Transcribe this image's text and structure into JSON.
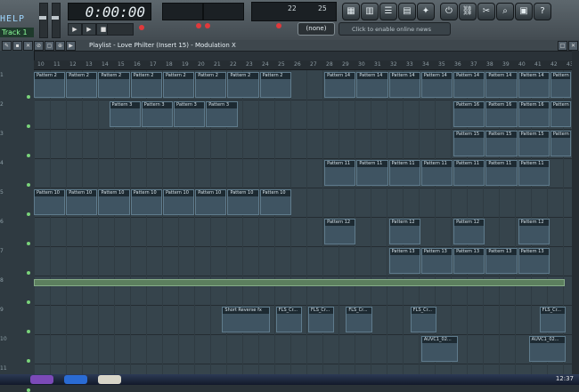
{
  "toolbar": {
    "help_label": "HELP",
    "track_label": "Track 1",
    "time": "0:00:00",
    "cpu": "22",
    "mem": "25",
    "mixer_preset": "(none)",
    "news_placeholder": "Click to enable online news"
  },
  "playlist": {
    "title": "Playlist - Love Philter (Insert 15) - Modulation X"
  },
  "ruler": {
    "bars": [
      10,
      11,
      12,
      13,
      14,
      15,
      16,
      17,
      18,
      19,
      20,
      21,
      22,
      23,
      24,
      25,
      26,
      27,
      28,
      29,
      30,
      31,
      32,
      33,
      34,
      35,
      36,
      37,
      38,
      39,
      40,
      41,
      42,
      43
    ]
  },
  "tracks": [
    {
      "num": "1"
    },
    {
      "num": "2"
    },
    {
      "num": "3"
    },
    {
      "num": "4"
    },
    {
      "num": "5"
    },
    {
      "num": "6"
    },
    {
      "num": "7"
    },
    {
      "num": "8"
    },
    {
      "num": "9"
    },
    {
      "num": "10"
    },
    {
      "num": "11"
    }
  ],
  "clips": [
    {
      "label": "Pattern 2",
      "track": 0,
      "start": 0,
      "len": 6
    },
    {
      "label": "Pattern 2",
      "track": 0,
      "start": 6,
      "len": 6
    },
    {
      "label": "Pattern 2",
      "track": 0,
      "start": 12,
      "len": 6
    },
    {
      "label": "Pattern 2",
      "track": 0,
      "start": 18,
      "len": 6
    },
    {
      "label": "Pattern 2",
      "track": 0,
      "start": 24,
      "len": 6
    },
    {
      "label": "Pattern 2",
      "track": 0,
      "start": 30,
      "len": 6
    },
    {
      "label": "Pattern 2",
      "track": 0,
      "start": 36,
      "len": 6
    },
    {
      "label": "Pattern 2",
      "track": 0,
      "start": 42,
      "len": 6
    },
    {
      "label": "Pattern 14",
      "track": 0,
      "start": 54,
      "len": 6
    },
    {
      "label": "Pattern 14",
      "track": 0,
      "start": 60,
      "len": 6
    },
    {
      "label": "Pattern 14",
      "track": 0,
      "start": 66,
      "len": 6
    },
    {
      "label": "Pattern 14",
      "track": 0,
      "start": 72,
      "len": 6
    },
    {
      "label": "Pattern 14",
      "track": 0,
      "start": 78,
      "len": 6
    },
    {
      "label": "Pattern 14",
      "track": 0,
      "start": 84,
      "len": 6
    },
    {
      "label": "Pattern 14",
      "track": 0,
      "start": 90,
      "len": 6
    },
    {
      "label": "Pattern",
      "track": 0,
      "start": 96,
      "len": 4
    },
    {
      "label": "Pattern 3",
      "track": 1,
      "start": 14,
      "len": 6
    },
    {
      "label": "Pattern 3",
      "track": 1,
      "start": 20,
      "len": 6
    },
    {
      "label": "Pattern 3",
      "track": 1,
      "start": 26,
      "len": 6
    },
    {
      "label": "Pattern 3",
      "track": 1,
      "start": 32,
      "len": 6
    },
    {
      "label": "Pattern 16",
      "track": 1,
      "start": 78,
      "len": 6
    },
    {
      "label": "Pattern 16",
      "track": 1,
      "start": 84,
      "len": 6
    },
    {
      "label": "Pattern 16",
      "track": 1,
      "start": 90,
      "len": 6
    },
    {
      "label": "Pattern",
      "track": 1,
      "start": 96,
      "len": 4
    },
    {
      "label": "Pattern 15",
      "track": 2,
      "start": 78,
      "len": 6
    },
    {
      "label": "Pattern 15",
      "track": 2,
      "start": 84,
      "len": 6
    },
    {
      "label": "Pattern 15",
      "track": 2,
      "start": 90,
      "len": 6
    },
    {
      "label": "Pattern",
      "track": 2,
      "start": 96,
      "len": 4
    },
    {
      "label": "Pattern 11",
      "track": 3,
      "start": 54,
      "len": 6
    },
    {
      "label": "Pattern 11",
      "track": 3,
      "start": 60,
      "len": 6
    },
    {
      "label": "Pattern 11",
      "track": 3,
      "start": 66,
      "len": 6
    },
    {
      "label": "Pattern 11",
      "track": 3,
      "start": 72,
      "len": 6
    },
    {
      "label": "Pattern 11",
      "track": 3,
      "start": 78,
      "len": 6
    },
    {
      "label": "Pattern 11",
      "track": 3,
      "start": 84,
      "len": 6
    },
    {
      "label": "Pattern 11",
      "track": 3,
      "start": 90,
      "len": 6
    },
    {
      "label": "Pattern 10",
      "track": 4,
      "start": 0,
      "len": 6
    },
    {
      "label": "Pattern 10",
      "track": 4,
      "start": 6,
      "len": 6
    },
    {
      "label": "Pattern 10",
      "track": 4,
      "start": 12,
      "len": 6
    },
    {
      "label": "Pattern 10",
      "track": 4,
      "start": 18,
      "len": 6
    },
    {
      "label": "Pattern 10",
      "track": 4,
      "start": 24,
      "len": 6
    },
    {
      "label": "Pattern 10",
      "track": 4,
      "start": 30,
      "len": 6
    },
    {
      "label": "Pattern 10",
      "track": 4,
      "start": 36,
      "len": 6
    },
    {
      "label": "Pattern 10",
      "track": 4,
      "start": 42,
      "len": 6
    },
    {
      "label": "Pattern 12",
      "track": 5,
      "start": 54,
      "len": 6
    },
    {
      "label": "Pattern 12",
      "track": 5,
      "start": 66,
      "len": 6
    },
    {
      "label": "Pattern 12",
      "track": 5,
      "start": 78,
      "len": 6
    },
    {
      "label": "Pattern 12",
      "track": 5,
      "start": 90,
      "len": 6
    },
    {
      "label": "Pattern 13",
      "track": 6,
      "start": 66,
      "len": 6
    },
    {
      "label": "Pattern 13",
      "track": 6,
      "start": 72,
      "len": 6
    },
    {
      "label": "Pattern 13",
      "track": 6,
      "start": 78,
      "len": 6
    },
    {
      "label": "Pattern 13",
      "track": 6,
      "start": 84,
      "len": 6
    },
    {
      "label": "Pattern 13",
      "track": 6,
      "start": 90,
      "len": 6
    },
    {
      "label": "Short Reverse fx",
      "track": 8,
      "start": 35,
      "len": 9
    },
    {
      "label": "FLS_Cr...",
      "track": 8,
      "start": 45,
      "len": 5
    },
    {
      "label": "FLS_Cr...",
      "track": 8,
      "start": 51,
      "len": 5
    },
    {
      "label": "FLS_Cr...",
      "track": 8,
      "start": 58,
      "len": 5
    },
    {
      "label": "FLS_Cr...",
      "track": 8,
      "start": 70,
      "len": 5
    },
    {
      "label": "FLS_Cr...",
      "track": 8,
      "start": 94,
      "len": 5
    },
    {
      "label": "AUVC1_02...",
      "track": 9,
      "start": 72,
      "len": 7
    },
    {
      "label": "AUVC1_02...",
      "track": 9,
      "start": 92,
      "len": 7
    }
  ],
  "taskbar": {
    "clock": "12:37"
  }
}
